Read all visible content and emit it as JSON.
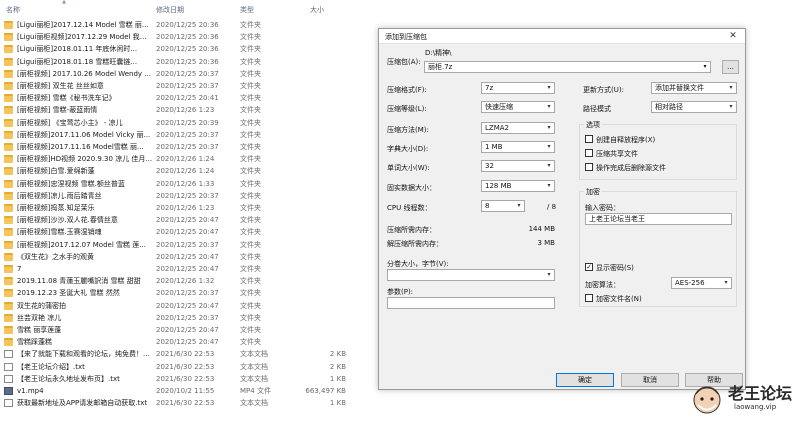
{
  "explorer": {
    "columns": {
      "name": "名称",
      "date": "修改日期",
      "type": "类型",
      "size": "大小"
    },
    "rows": [
      {
        "icon": "folder",
        "name": "[Ligui丽柜]2017.12.14 Model 雪糕 丽...",
        "date": "2020/12/25 20:36",
        "type": "文件夹",
        "size": ""
      },
      {
        "icon": "folder",
        "name": "[Ligui丽柜视频]2017.12.29 Model 我子...",
        "date": "2020/12/25 20:36",
        "type": "文件夹",
        "size": ""
      },
      {
        "icon": "folder",
        "name": "[Ligui丽柜]2018.01.11 年底休闲时...",
        "date": "2020/12/25 20:36",
        "type": "文件夹",
        "size": ""
      },
      {
        "icon": "folder",
        "name": "[Ligui丽柜]2018.01.18 雪糕旺囊链...",
        "date": "2020/12/25 20:36",
        "type": "文件夹",
        "size": ""
      },
      {
        "icon": "folder",
        "name": "[丽柜视频] 2017.10.26 Model Wendy ...",
        "date": "2020/12/25 20:37",
        "type": "文件夹",
        "size": ""
      },
      {
        "icon": "folder",
        "name": "[丽柜视频] 双生花 丝丝如意",
        "date": "2020/12/25 20:37",
        "type": "文件夹",
        "size": ""
      },
      {
        "icon": "folder",
        "name": "[丽柜视频] 雪糕《秘书洗车记》",
        "date": "2020/12/25 20:41",
        "type": "文件夹",
        "size": ""
      },
      {
        "icon": "folder",
        "name": "[丽柜视频] 雪糕-蔽蓝雨情",
        "date": "2020/12/26 1:23",
        "type": "文件夹",
        "size": ""
      },
      {
        "icon": "folder",
        "name": "[丽柜视频] 《宝莺芯小主》 - 凉儿",
        "date": "2020/12/25 20:39",
        "type": "文件夹",
        "size": ""
      },
      {
        "icon": "folder",
        "name": "[丽柜视频]2017.11.06 Model Vicky 丽...",
        "date": "2020/12/25 20:37",
        "type": "文件夹",
        "size": ""
      },
      {
        "icon": "folder",
        "name": "[丽柜视频]2017.11.16 Model雪糕 丽...",
        "date": "2020/12/25 20:37",
        "type": "文件夹",
        "size": ""
      },
      {
        "icon": "folder",
        "name": "[丽柜视频]HD视频 2020.9.30 凉儿 佳月...",
        "date": "2020/12/26 1:24",
        "type": "文件夹",
        "size": ""
      },
      {
        "icon": "folder",
        "name": "[丽柜视频]白雪.爱绵新蓬",
        "date": "2020/12/26 1:24",
        "type": "文件夹",
        "size": ""
      },
      {
        "icon": "folder",
        "name": "[丽柜视频]忠涅视频 雪糕.额丝普蓝",
        "date": "2020/12/26 1:33",
        "type": "文件夹",
        "size": ""
      },
      {
        "icon": "folder",
        "name": "[丽柜视频]凉儿.雨后踏青丝",
        "date": "2020/12/25 20:37",
        "type": "文件夹",
        "size": ""
      },
      {
        "icon": "folder",
        "name": "[丽柜视频]捣蒸.知足茉乐",
        "date": "2020/12/26 1:23",
        "type": "文件夹",
        "size": ""
      },
      {
        "icon": "folder",
        "name": "[丽柜视频]沙沙.双人花.春情丝意",
        "date": "2020/12/25 20:47",
        "type": "文件夹",
        "size": ""
      },
      {
        "icon": "folder",
        "name": "[丽柜视频]雪糕.玉赛湿销魂",
        "date": "2020/12/25 20:47",
        "type": "文件夹",
        "size": ""
      },
      {
        "icon": "folder",
        "name": "[丽柜视频]2017.12.07 Model 雪糕 莲...",
        "date": "2020/12/25 20:37",
        "type": "文件夹",
        "size": ""
      },
      {
        "icon": "folder",
        "name": "《双生花》之水手的观黄",
        "date": "2020/12/25 20:47",
        "type": "文件夹",
        "size": ""
      },
      {
        "icon": "folder",
        "name": "7",
        "date": "2020/12/25 20:47",
        "type": "文件夹",
        "size": ""
      },
      {
        "icon": "folder",
        "name": "2019.11.08 青蓮玉麗嘴訳消 雪糕 甜甜",
        "date": "2020/12/26 1:32",
        "type": "文件夹",
        "size": ""
      },
      {
        "icon": "folder",
        "name": "2019.12.23 圣诞大礼 雪糕 然然",
        "date": "2020/12/25 20:37",
        "type": "文件夹",
        "size": ""
      },
      {
        "icon": "folder",
        "name": "双生花的蒲密拍",
        "date": "2020/12/25 20:47",
        "type": "文件夹",
        "size": ""
      },
      {
        "icon": "folder",
        "name": "丝芸双艳 凉儿",
        "date": "2020/12/25 20:37",
        "type": "文件夹",
        "size": ""
      },
      {
        "icon": "folder",
        "name": "雪糕 丽享莲蓬",
        "date": "2020/12/25 20:47",
        "type": "文件夹",
        "size": ""
      },
      {
        "icon": "folder",
        "name": "雪糕踩蓬糕",
        "date": "2020/12/25 20:47",
        "type": "文件夹",
        "size": ""
      },
      {
        "icon": "doc",
        "name": "【来了就能下载和观看的论坛，纯免费！...",
        "date": "2021/6/30 22:53",
        "type": "文本文档",
        "size": "2 KB"
      },
      {
        "icon": "doc",
        "name": "【老王论坛介绍】.txt",
        "date": "2021/6/30 22:53",
        "type": "文本文档",
        "size": "2 KB"
      },
      {
        "icon": "doc",
        "name": "【老王论坛永久地址发布页】.txt",
        "date": "2021/6/30 22:53",
        "type": "文本文档",
        "size": "1 KB"
      },
      {
        "icon": "video",
        "name": "v1.mp4",
        "date": "2020/10/2 11:55",
        "type": "MP4 文件",
        "size": "663,497 KB"
      },
      {
        "icon": "doc",
        "name": "获取最新地址及APP请发邮箱自动获取.txt",
        "date": "2021/6/30 22:53",
        "type": "文本文档",
        "size": "1 KB"
      }
    ]
  },
  "dialog": {
    "title": "添加到压缩包",
    "close": "✕",
    "archive_label": "压缩包(A):",
    "archive_path": "D:\\精神\\",
    "archive_name": "丽柜.7z",
    "browse_label": "...",
    "format_label": "压缩格式(F):",
    "format_value": "7z",
    "level_label": "压缩等级(L):",
    "level_value": "快速压缩",
    "method_label": "压缩方法(M):",
    "method_value": "LZMA2",
    "dict_label": "字典大小(D):",
    "dict_value": "1 MB",
    "word_label": "单词大小(W):",
    "word_value": "32",
    "solid_label": "固实数据大小：",
    "solid_value": "128 MB",
    "cpu_label": "CPU 线程数：",
    "cpu_value": "8",
    "cpu_total": "/ 8",
    "mem_comp_label": "压缩所需内存：",
    "mem_comp_value": "144 MB",
    "mem_decomp_label": "解压缩所需内存：",
    "mem_decomp_value": "3 MB",
    "split_label": "分卷大小，字节(V):",
    "split_value": "",
    "params_label": "参数(P):",
    "params_value": "",
    "update_label": "更新方式(U):",
    "update_value": "添加并替换文件",
    "path_label": "路径模式",
    "path_value": "相对路径",
    "options_title": "选项",
    "opt_sfx": "创建自释放程序(X)",
    "opt_shared": "压缩共享文件",
    "opt_delete": "操作完成后删除源文件",
    "encrypt_title": "加密",
    "password_label": "输入密码：",
    "password_value": "上老王论坛当老王",
    "show_password": "显示密码(S)",
    "enc_method_label": "加密算法：",
    "enc_method_value": "AES-256",
    "enc_names": "加密文件名(N)",
    "ok": "确定",
    "cancel": "取消",
    "help": "帮助"
  },
  "watermark": {
    "title": "老王论坛",
    "url": "laowang.vip"
  }
}
